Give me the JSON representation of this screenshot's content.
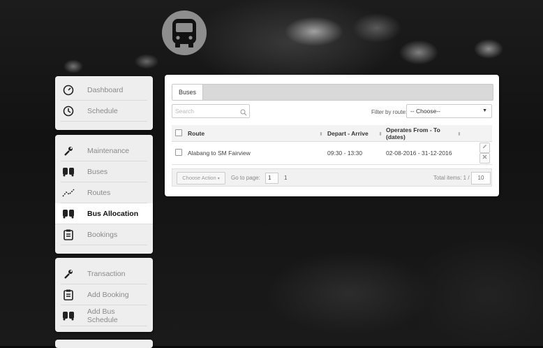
{
  "sidebar": {
    "group1": [
      {
        "label": "Dashboard",
        "icon": "clock-gauge-icon"
      },
      {
        "label": "Schedule",
        "icon": "clock-icon"
      }
    ],
    "group2": [
      {
        "label": "Maintenance",
        "icon": "wrench-icon"
      },
      {
        "label": "Buses",
        "icon": "bus-icon"
      },
      {
        "label": "Routes",
        "icon": "route-icon"
      },
      {
        "label": "Bus Allocation",
        "icon": "bus-icon",
        "active": true
      },
      {
        "label": "Bookings",
        "icon": "clipboard-icon"
      }
    ],
    "group3": [
      {
        "label": "Transaction",
        "icon": "wrench-icon"
      },
      {
        "label": "Add Booking",
        "icon": "clipboard-icon"
      },
      {
        "label": "Add Bus Schedule",
        "icon": "bus-icon"
      }
    ]
  },
  "panel": {
    "tab": "Buses",
    "search_placeholder": "Search",
    "filter_label": "Filter by route:",
    "filter_value": "-- Choose--",
    "columns": [
      "Route",
      "Depart - Arrive",
      "Operates From - To (dates)"
    ],
    "rows": [
      {
        "route": "Alabang to SM Fairview",
        "time": "09:30 - 13:30",
        "dates": "02-08-2016 - 31-12-2016"
      }
    ],
    "footer": {
      "choose_action": "Choose Action",
      "goto_label": "Go to page:",
      "page_input": "1",
      "page_count": "1",
      "total_label": "Total items: 1 /",
      "per_page": "10"
    }
  },
  "colors": {
    "active_bg": "#ffffff",
    "panel_bg": "#ffffff",
    "sidebar_bg": "#eeeeee"
  }
}
